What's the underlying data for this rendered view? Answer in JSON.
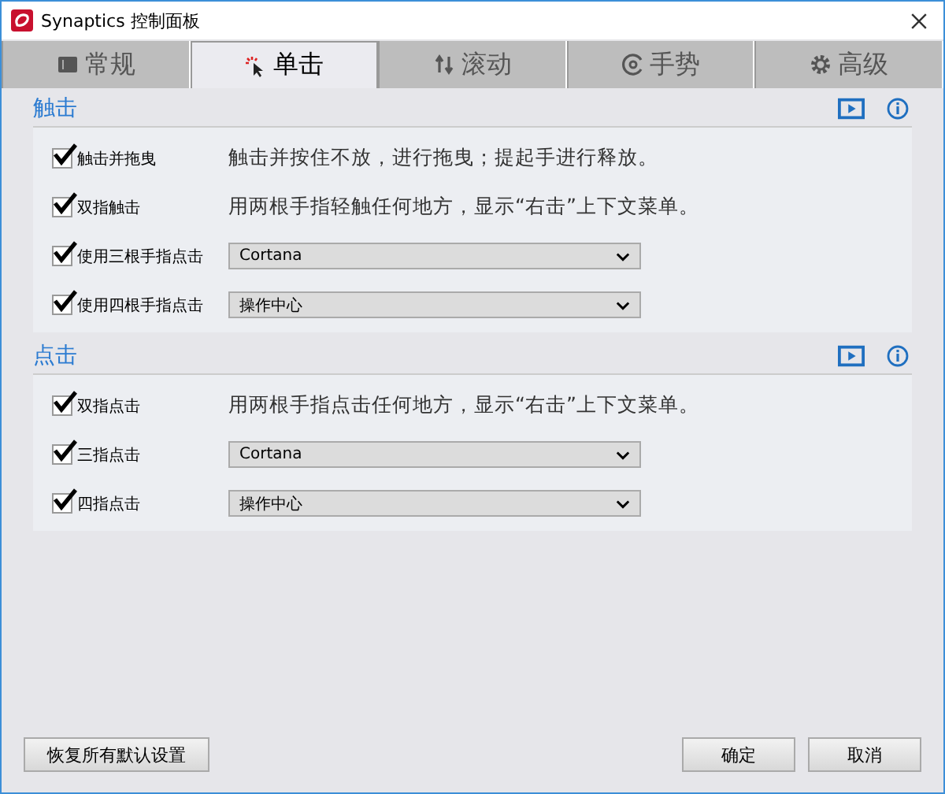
{
  "window": {
    "title": "Synaptics 控制面板"
  },
  "tabs": [
    {
      "label": "常规",
      "selected": false
    },
    {
      "label": "单击",
      "selected": true
    },
    {
      "label": "滚动",
      "selected": false
    },
    {
      "label": "手势",
      "selected": false
    },
    {
      "label": "高级",
      "selected": false
    }
  ],
  "sections": [
    {
      "title": "触击",
      "items": [
        {
          "kind": "description",
          "label": "触击并拖曳",
          "checked": true,
          "text": "触击并按住不放，进行拖曳；提起手进行释放。"
        },
        {
          "kind": "description",
          "label": "双指触击",
          "checked": true,
          "text": "用两根手指轻触任何地方，显示“右击”上下文菜单。"
        },
        {
          "kind": "dropdown",
          "label": "使用三根手指点击",
          "checked": true,
          "value": "Cortana"
        },
        {
          "kind": "dropdown",
          "label": "使用四根手指点击",
          "checked": true,
          "value": "操作中心"
        }
      ]
    },
    {
      "title": "点击",
      "items": [
        {
          "kind": "description",
          "label": "双指点击",
          "checked": true,
          "text": "用两根手指点击任何地方，显示“右击”上下文菜单。"
        },
        {
          "kind": "dropdown",
          "label": "三指点击",
          "checked": true,
          "value": "Cortana"
        },
        {
          "kind": "dropdown",
          "label": "四指点击",
          "checked": true,
          "value": "操作中心"
        }
      ]
    }
  ],
  "footer": {
    "restore": "恢复所有默认设置",
    "buttons": [
      "确定",
      "取消"
    ]
  }
}
